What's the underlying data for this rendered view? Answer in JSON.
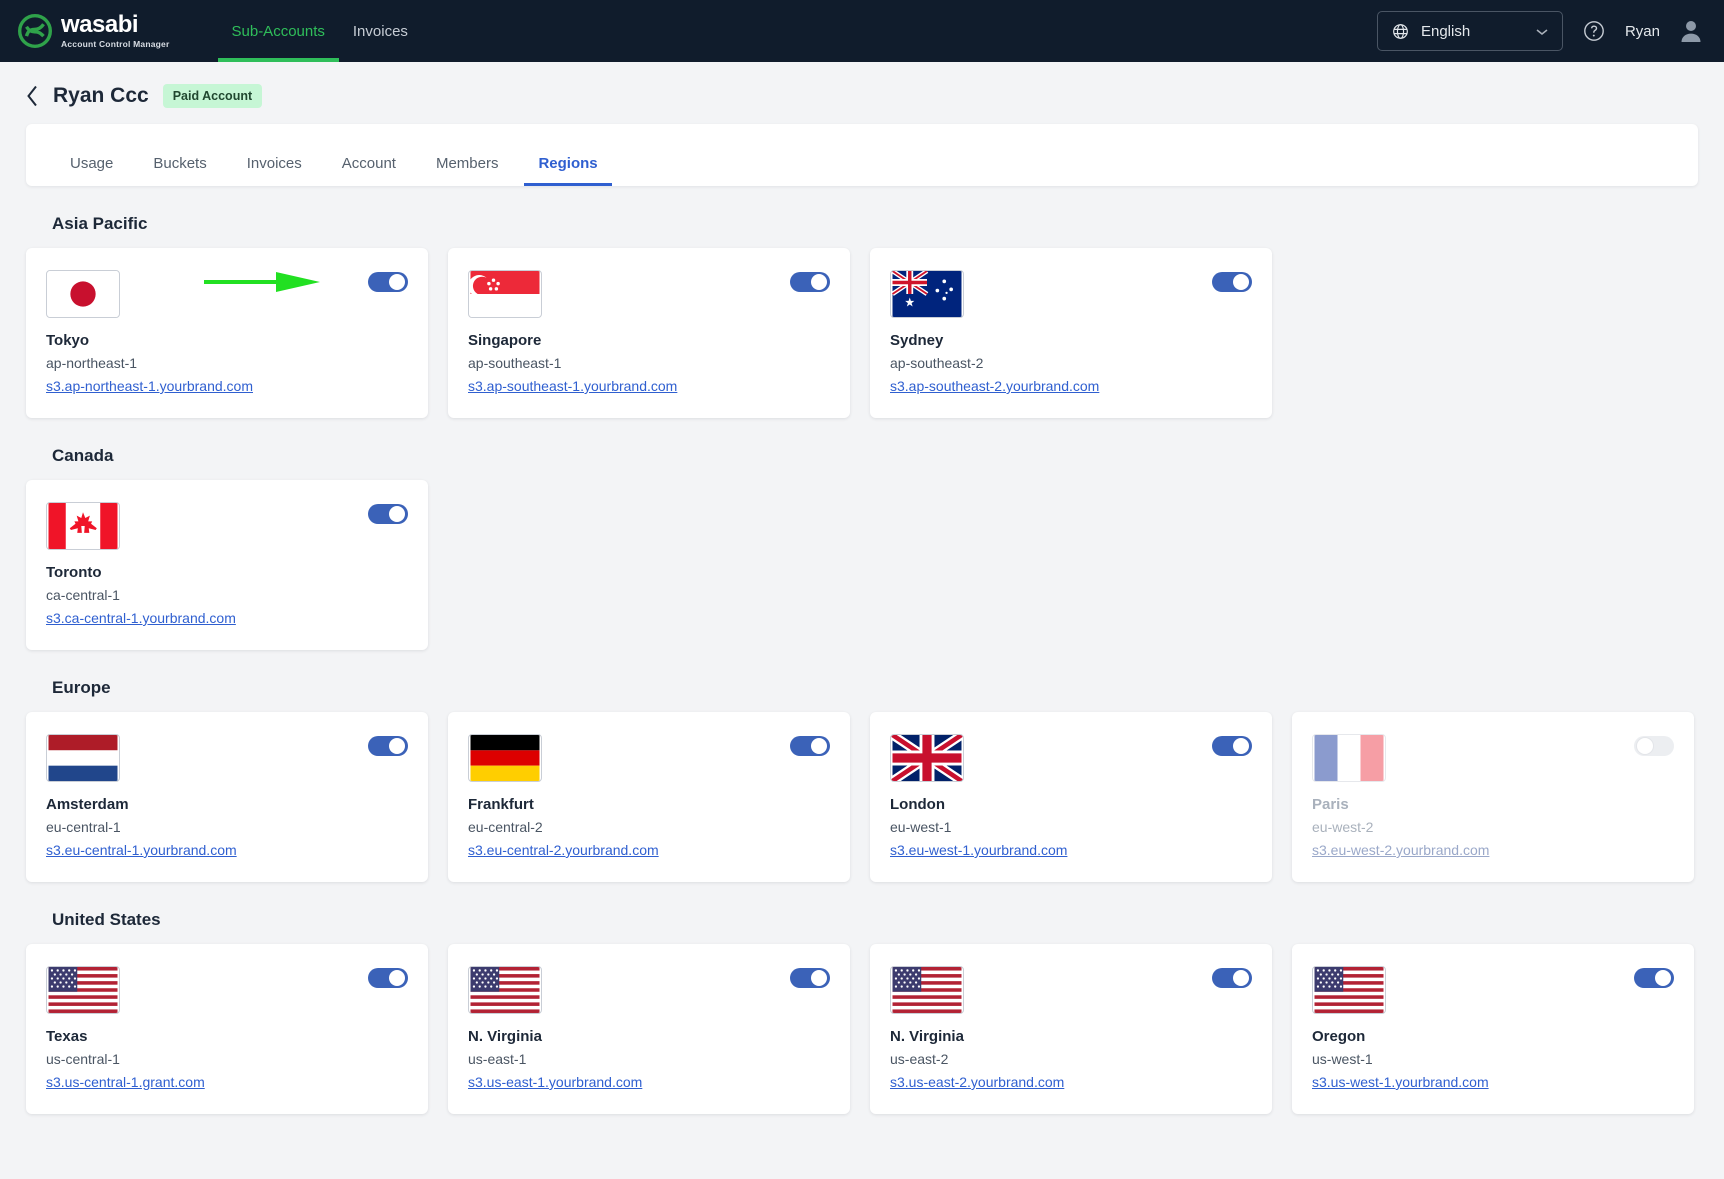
{
  "header": {
    "logo_word": "wasabi",
    "logo_sub": "Account Control Manager",
    "nav": [
      {
        "label": "Sub-Accounts",
        "active": true
      },
      {
        "label": "Invoices",
        "active": false
      }
    ],
    "language": "English",
    "language_icon": "globe-icon",
    "chevron_icon": "chevron-down-icon",
    "help_icon": "question-circle-icon",
    "user_name": "Ryan",
    "avatar_icon": "user-avatar-icon",
    "bg_color": "#101c2c",
    "accent_color": "#2fbe5a"
  },
  "page": {
    "back_icon": "chevron-left-icon",
    "title": "Ryan Ccc",
    "badge": "Paid Account",
    "badge_bg": "#c6f6d5"
  },
  "tabs": [
    {
      "label": "Usage",
      "active": false
    },
    {
      "label": "Buckets",
      "active": false
    },
    {
      "label": "Invoices",
      "active": false
    },
    {
      "label": "Account",
      "active": false
    },
    {
      "label": "Members",
      "active": false
    },
    {
      "label": "Regions",
      "active": true
    }
  ],
  "annotation": {
    "type": "arrow",
    "color": "#22e022",
    "points_to": "tokyo-region-toggle"
  },
  "groups": [
    {
      "title": "Asia Pacific",
      "regions": [
        {
          "name": "Tokyo",
          "code": "ap-northeast-1",
          "link": "s3.ap-northeast-1.yourbrand.com",
          "flag": "jp",
          "enabled": true,
          "annotated": true
        },
        {
          "name": "Singapore",
          "code": "ap-southeast-1",
          "link": "s3.ap-southeast-1.yourbrand.com",
          "flag": "sg",
          "enabled": true,
          "annotated": false
        },
        {
          "name": "Sydney",
          "code": "ap-southeast-2",
          "link": "s3.ap-southeast-2.yourbrand.com",
          "flag": "au",
          "enabled": true,
          "annotated": false
        }
      ]
    },
    {
      "title": "Canada",
      "regions": [
        {
          "name": "Toronto",
          "code": "ca-central-1",
          "link": "s3.ca-central-1.yourbrand.com",
          "flag": "ca",
          "enabled": true,
          "annotated": false
        }
      ]
    },
    {
      "title": "Europe",
      "regions": [
        {
          "name": "Amsterdam",
          "code": "eu-central-1",
          "link": "s3.eu-central-1.yourbrand.com",
          "flag": "nl",
          "enabled": true,
          "annotated": false
        },
        {
          "name": "Frankfurt",
          "code": "eu-central-2",
          "link": "s3.eu-central-2.yourbrand.com",
          "flag": "de",
          "enabled": true,
          "annotated": false
        },
        {
          "name": "London",
          "code": "eu-west-1",
          "link": "s3.eu-west-1.yourbrand.com",
          "flag": "gb",
          "enabled": true,
          "annotated": false
        },
        {
          "name": "Paris",
          "code": "eu-west-2",
          "link": "s3.eu-west-2.yourbrand.com",
          "flag": "fr",
          "enabled": false,
          "annotated": false
        }
      ]
    },
    {
      "title": "United States",
      "regions": [
        {
          "name": "Texas",
          "code": "us-central-1",
          "link": "s3.us-central-1.grant.com",
          "flag": "us",
          "enabled": true,
          "annotated": false
        },
        {
          "name": "N. Virginia",
          "code": "us-east-1",
          "link": "s3.us-east-1.yourbrand.com",
          "flag": "us",
          "enabled": true,
          "annotated": false
        },
        {
          "name": "N. Virginia",
          "code": "us-east-2",
          "link": "s3.us-east-2.yourbrand.com",
          "flag": "us",
          "enabled": true,
          "annotated": false
        },
        {
          "name": "Oregon",
          "code": "us-west-1",
          "link": "s3.us-west-1.yourbrand.com",
          "flag": "us",
          "enabled": true,
          "annotated": false
        }
      ]
    }
  ]
}
